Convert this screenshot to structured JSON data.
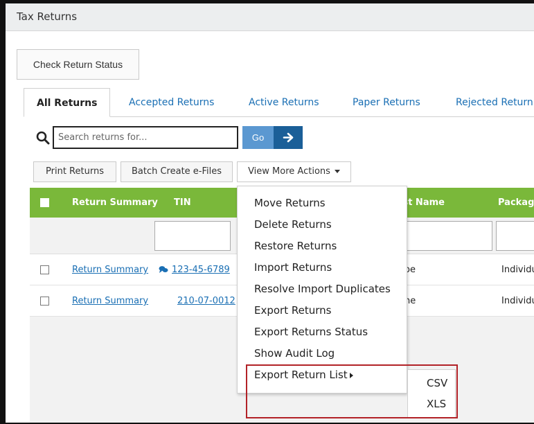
{
  "window": {
    "title": "Tax Returns"
  },
  "actions": {
    "check_status": "Check Return Status"
  },
  "tabs": [
    "All Returns",
    "Accepted Returns",
    "Active Returns",
    "Paper Returns",
    "Rejected Return"
  ],
  "search": {
    "placeholder": "Search returns for...",
    "go_label": "Go"
  },
  "toolbar": {
    "print": "Print Returns",
    "batch": "Batch Create e-Files",
    "more": "View More Actions"
  },
  "grid": {
    "columns": [
      "Return Summary",
      "TIN",
      "ist Name",
      "Package"
    ],
    "rows": [
      {
        "summary": "Return Summary",
        "tin": "123-45-6789",
        "name": "oe",
        "package": "Individua"
      },
      {
        "summary": "Return Summary",
        "tin": "210-07-0012",
        "name": "ne",
        "package": "Individua"
      }
    ]
  },
  "menu": {
    "items": [
      "Move Returns",
      "Delete Returns",
      "Restore Returns",
      "Import Returns",
      "Resolve Import Duplicates",
      "Export Returns",
      "Export Returns Status",
      "Show Audit Log",
      "Export Return List"
    ]
  },
  "submenu": {
    "items": [
      "CSV",
      "XLS"
    ]
  },
  "colors": {
    "accent_green": "#7ab83a",
    "link_blue": "#1a6fb4",
    "go_blue": "#5b98d1",
    "arrow_blue": "#1b5f98",
    "highlight_red": "#b22227"
  },
  "icons": {
    "search": "search-icon",
    "arrow": "arrow-right-icon",
    "comment": "comment-icon",
    "caret": "caret-down-icon"
  }
}
